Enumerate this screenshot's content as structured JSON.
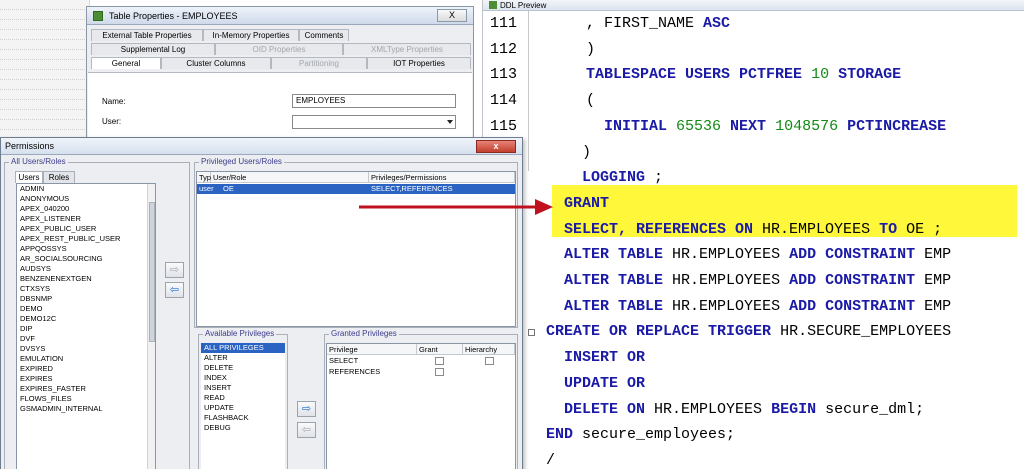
{
  "ddl_preview": {
    "title": "DDL Preview",
    "lines": [
      {
        "n": "111",
        "parts": [
          {
            "t": "      , FIRST_NAME ",
            "c": ""
          },
          {
            "t": "ASC",
            "c": "kw"
          }
        ]
      },
      {
        "n": "112",
        "parts": [
          {
            "t": "      )",
            "c": ""
          }
        ]
      },
      {
        "n": "113",
        "parts": [
          {
            "t": "      ",
            "c": ""
          },
          {
            "t": "TABLESPACE USERS PCTFREE ",
            "c": "kw"
          },
          {
            "t": "10",
            "c": "num"
          },
          {
            "t": " STORAGE",
            "c": "kw"
          }
        ]
      },
      {
        "n": "114",
        "parts": [
          {
            "t": "      (",
            "c": ""
          }
        ]
      },
      {
        "n": "115",
        "parts": [
          {
            "t": "        ",
            "c": ""
          },
          {
            "t": "INITIAL ",
            "c": "kw"
          },
          {
            "t": "65536",
            "c": "num"
          },
          {
            "t": " NEXT ",
            "c": "kw"
          },
          {
            "t": "1048576",
            "c": "num"
          },
          {
            "t": " PCTINCREASE",
            "c": "kw"
          }
        ]
      },
      {
        "n": "",
        "parts": [
          {
            "t": "      )",
            "c": ""
          }
        ]
      },
      {
        "n": "",
        "parts": [
          {
            "t": "      ",
            "c": ""
          },
          {
            "t": "LOGGING",
            "c": "kw"
          },
          {
            "t": " ;",
            "c": ""
          }
        ]
      },
      {
        "n": "",
        "parts": [
          {
            "t": "    ",
            "c": ""
          },
          {
            "t": "GRANT",
            "c": "kw"
          }
        ]
      },
      {
        "n": "",
        "parts": [
          {
            "t": "    ",
            "c": ""
          },
          {
            "t": "SELECT, REFERENCES ON",
            "c": "kw"
          },
          {
            "t": " HR.EMPLOYEES ",
            "c": ""
          },
          {
            "t": "TO",
            "c": "kw"
          },
          {
            "t": " OE ;",
            "c": ""
          }
        ]
      },
      {
        "n": "",
        "parts": [
          {
            "t": "    ",
            "c": ""
          },
          {
            "t": "ALTER TABLE",
            "c": "kw"
          },
          {
            "t": " HR.EMPLOYEES ",
            "c": ""
          },
          {
            "t": "ADD CONSTRAINT",
            "c": "kw"
          },
          {
            "t": " EMP",
            "c": ""
          }
        ]
      },
      {
        "n": "",
        "parts": [
          {
            "t": "    ",
            "c": ""
          },
          {
            "t": "ALTER TABLE",
            "c": "kw"
          },
          {
            "t": " HR.EMPLOYEES ",
            "c": ""
          },
          {
            "t": "ADD CONSTRAINT",
            "c": "kw"
          },
          {
            "t": " EMP",
            "c": ""
          }
        ]
      },
      {
        "n": "",
        "parts": [
          {
            "t": "    ",
            "c": ""
          },
          {
            "t": "ALTER TABLE",
            "c": "kw"
          },
          {
            "t": " HR.EMPLOYEES ",
            "c": ""
          },
          {
            "t": "ADD CONSTRAINT",
            "c": "kw"
          },
          {
            "t": " EMP",
            "c": ""
          }
        ]
      },
      {
        "n": "",
        "parts": [
          {
            "t": "  ",
            "c": ""
          },
          {
            "t": "CREATE OR REPLACE TRIGGER",
            "c": "kw"
          },
          {
            "t": " HR.SECURE_EMPLOYEES",
            "c": ""
          }
        ]
      },
      {
        "n": "",
        "parts": [
          {
            "t": "    ",
            "c": ""
          },
          {
            "t": "INSERT OR",
            "c": "kw"
          }
        ]
      },
      {
        "n": "",
        "parts": [
          {
            "t": "    ",
            "c": ""
          },
          {
            "t": "UPDATE OR",
            "c": "kw"
          }
        ]
      },
      {
        "n": "",
        "parts": [
          {
            "t": "    ",
            "c": ""
          },
          {
            "t": "DELETE ON",
            "c": "kw"
          },
          {
            "t": " HR.EMPLOYEES ",
            "c": ""
          },
          {
            "t": "BEGIN",
            "c": "kw"
          },
          {
            "t": " secure_dml;",
            "c": ""
          }
        ]
      },
      {
        "n": "",
        "parts": [
          {
            "t": "  ",
            "c": ""
          },
          {
            "t": "END",
            "c": "kw"
          },
          {
            "t": " secure_employees;",
            "c": ""
          }
        ]
      },
      {
        "n": "",
        "parts": [
          {
            "t": "  /",
            "c": ""
          }
        ]
      }
    ]
  },
  "table_properties": {
    "title": "Table Properties - EMPLOYEES",
    "close_label": "X",
    "tabs_row1": [
      "External Table Properties",
      "In-Memory Properties",
      "Comments"
    ],
    "tabs_row2": [
      "Supplemental Log",
      "OID Properties",
      "XMLType Properties"
    ],
    "tabs_row3": [
      "General",
      "Cluster Columns",
      "Partitioning",
      "IOT Properties"
    ],
    "name_label": "Name:",
    "name_value": "EMPLOYEES",
    "user_label": "User:",
    "user_value": ""
  },
  "permissions": {
    "title": "Permissions",
    "close_label": "x",
    "all_users_group": "All Users/Roles",
    "tab_users": "Users",
    "tab_roles": "Roles",
    "users": [
      "ADMIN",
      "ANONYMOUS",
      "APEX_040200",
      "APEX_LISTENER",
      "APEX_PUBLIC_USER",
      "APEX_REST_PUBLIC_USER",
      "APPQOSSYS",
      "AR_SOCIALSOURCING",
      "AUDSYS",
      "BENZENENEXTGEN",
      "CTXSYS",
      "DBSNMP",
      "DEMO",
      "DEMO12C",
      "DIP",
      "DVF",
      "DVSYS",
      "EMULATION",
      "EXPIRED",
      "EXPIRES",
      "EXPIRES_FASTER",
      "FLOWS_FILES",
      "GSMADMIN_INTERNAL"
    ],
    "privileged_group": "Privileged Users/Roles",
    "priv_headers": [
      "Type",
      "User/Role",
      "Privileges/Permissions"
    ],
    "priv_rows": [
      {
        "type": "user",
        "user": "OE",
        "privs": "SELECT,REFERENCES"
      }
    ],
    "available_group": "Available Privileges",
    "available": [
      "ALL PRIVILEGES",
      "ALTER",
      "DELETE",
      "INDEX",
      "INSERT",
      "READ",
      "UPDATE",
      "FLASHBACK",
      "DEBUG"
    ],
    "granted_group": "Granted Privileges",
    "granted_headers": [
      "Privilege",
      "Grant",
      "Hierarchy"
    ],
    "granted_rows": [
      {
        "privilege": "SELECT",
        "grant": false,
        "hierarchy": false
      },
      {
        "privilege": "REFERENCES",
        "grant": false,
        "hierarchy": null
      }
    ]
  },
  "colors": {
    "keyword": "#1a1aa6",
    "number": "#138a13",
    "highlight": "#fff83a",
    "selection": "#2b63c2",
    "annotation_arrow": "#c0111f"
  },
  "icons": [
    "ddl-preview-icon",
    "table-properties-icon",
    "arrow-right-icon",
    "arrow-left-icon",
    "dropdown-arrow-icon",
    "close-icon"
  ]
}
